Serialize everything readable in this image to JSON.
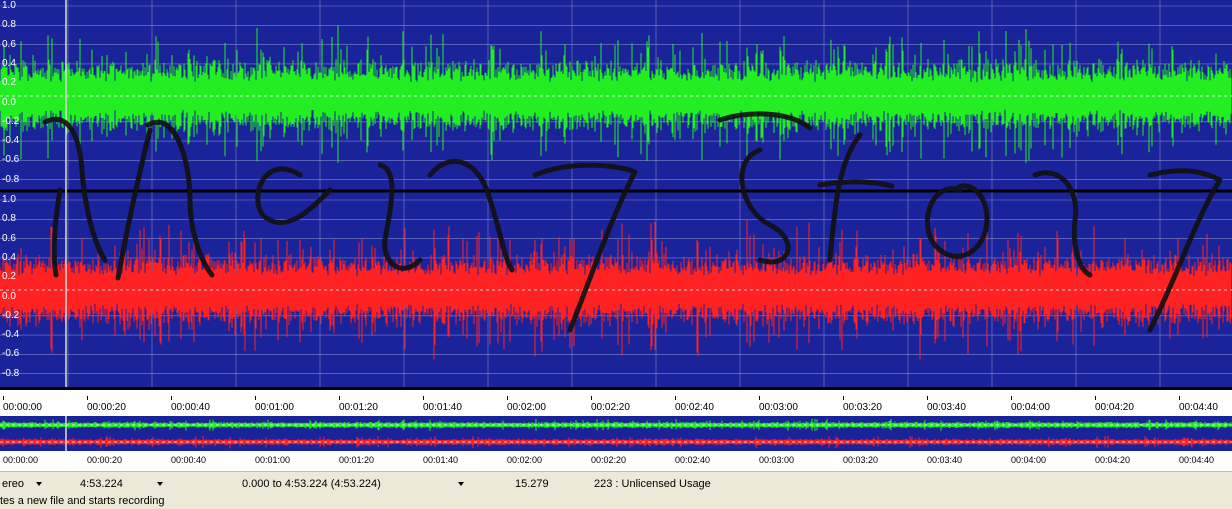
{
  "waveform": {
    "channel_top_labels": [
      "1.0",
      "0.8",
      "0.6",
      "0.4",
      "0.2",
      "0.0",
      "-0.2",
      "-0.4",
      "-0.6",
      "-0.8"
    ],
    "channel_bottom_labels": [
      "1.0",
      "0.8",
      "0.6",
      "0.4",
      "0.2",
      "0.0",
      "-0.2",
      "-0.4",
      "-0.6",
      "-0.8"
    ],
    "colors": {
      "background": "#1a239a",
      "left_channel": "#22ee22",
      "right_channel": "#ff2222",
      "grid": "#7f86c8"
    }
  },
  "timeline": {
    "ticks": [
      "00:00:00",
      "00:00:20",
      "00:00:40",
      "00:01:00",
      "00:01:20",
      "00:01:40",
      "00:02:00",
      "00:02:20",
      "00:02:40",
      "00:03:00",
      "00:03:20",
      "00:03:40",
      "00:04:00",
      "00:04:20",
      "00:04:40"
    ]
  },
  "status": {
    "channels": "ereo",
    "length": "4:53.224",
    "selection": "0.000 to 4:53.224 (4:53.224)",
    "value": "15.279",
    "license": "223 : Unlicensed Usage"
  },
  "hint": "tes a new file and starts recording"
}
